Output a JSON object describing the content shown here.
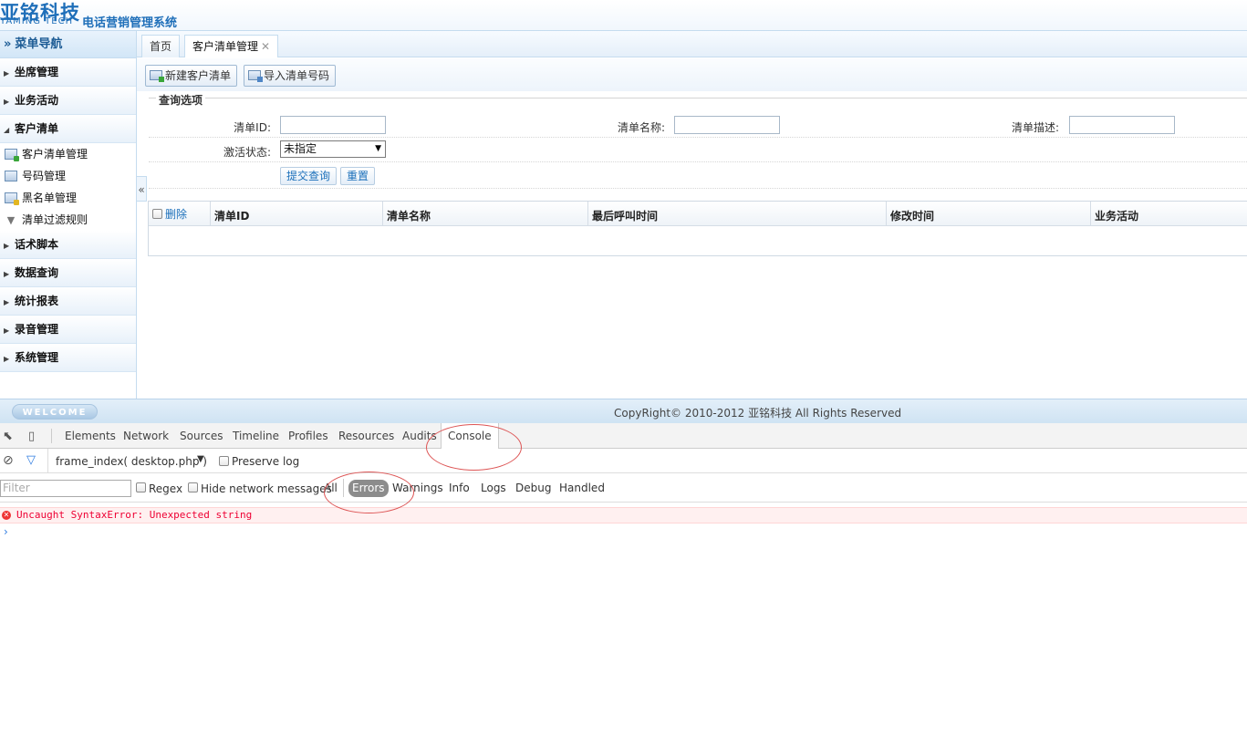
{
  "header": {
    "logo_cn": "亚铭科技",
    "logo_en": "YAMING TECH",
    "system_title": "电话营销管理系统"
  },
  "sidebar": {
    "title": "菜单导航",
    "groups": [
      {
        "label": "坐席管理"
      },
      {
        "label": "业务活动"
      },
      {
        "label": "客户清单",
        "expanded": true,
        "items": [
          {
            "label": "客户清单管理",
            "icon": "list-add-icon"
          },
          {
            "label": "号码管理",
            "icon": "list-icon"
          },
          {
            "label": "黑名单管理",
            "icon": "list-warn-icon"
          },
          {
            "label": "清单过滤规则",
            "icon": "filter-icon"
          }
        ]
      },
      {
        "label": "话术脚本"
      },
      {
        "label": "数据查询"
      },
      {
        "label": "统计报表"
      },
      {
        "label": "录音管理"
      },
      {
        "label": "系统管理"
      }
    ],
    "collapse_glyph": "«"
  },
  "tabs": [
    {
      "label": "首页"
    },
    {
      "label": "客户清单管理",
      "active": true,
      "close": "✕"
    }
  ],
  "toolbar": {
    "new_label": "新建客户清单",
    "import_label": "导入清单号码"
  },
  "query": {
    "legend": "查询选项",
    "id_label": "清单ID:",
    "name_label": "清单名称:",
    "desc_label": "清单描述:",
    "status_label": "激活状态:",
    "status_value": "未指定",
    "submit_label": "提交查询",
    "reset_label": "重置"
  },
  "grid": {
    "delete_label": "删除",
    "columns": [
      "清单ID",
      "清单名称",
      "最后呼叫时间",
      "修改时间",
      "业务活动"
    ]
  },
  "footer": {
    "welcome": "WELCOME",
    "copyright": "CopyRight© 2010-2012 亚铭科技 All Rights Reserved"
  },
  "devtools": {
    "tabs": [
      "Elements",
      "Network",
      "Sources",
      "Timeline",
      "Profiles",
      "Resources",
      "Audits",
      "Console"
    ],
    "active_tab": "Console",
    "context": "frame_index( desktop.php )",
    "preserve_log": "Preserve log",
    "filter_placeholder": "Filter",
    "regex": "Regex",
    "hide_network": "Hide network messages",
    "levels": [
      "All",
      "Errors",
      "Warnings",
      "Info",
      "Logs",
      "Debug",
      "Handled"
    ],
    "active_level": "Errors",
    "error_message": "Uncaught SyntaxError: Unexpected string",
    "prompt": "›"
  },
  "colors": {
    "brand": "#1f6fb9",
    "error": "#e03",
    "annotation": "#d55"
  }
}
